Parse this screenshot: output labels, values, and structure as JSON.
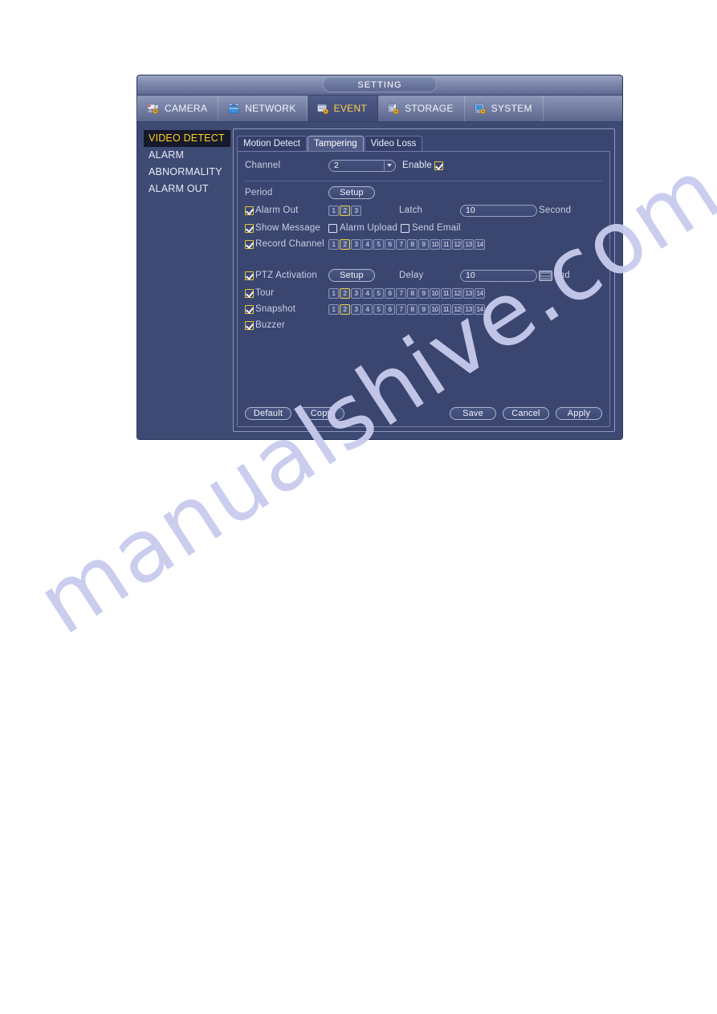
{
  "window": {
    "title": "SETTING"
  },
  "main_tabs": [
    {
      "label": "CAMERA",
      "icon": "camera-gear-icon",
      "active": false
    },
    {
      "label": "NETWORK",
      "icon": "network-icon",
      "active": false
    },
    {
      "label": "EVENT",
      "icon": "event-gear-icon",
      "active": true
    },
    {
      "label": "STORAGE",
      "icon": "storage-gear-icon",
      "active": false
    },
    {
      "label": "SYSTEM",
      "icon": "system-gear-icon",
      "active": false
    }
  ],
  "sidebar": {
    "items": [
      {
        "label": "VIDEO DETECT",
        "active": true
      },
      {
        "label": "ALARM",
        "active": false
      },
      {
        "label": "ABNORMALITY",
        "active": false
      },
      {
        "label": "ALARM OUT",
        "active": false
      }
    ]
  },
  "sub_tabs": [
    {
      "label": "Motion Detect",
      "active": false
    },
    {
      "label": "Tampering",
      "active": true
    },
    {
      "label": "Video Loss",
      "active": false
    }
  ],
  "form": {
    "channel_label": "Channel",
    "channel_value": "2",
    "enable_label": "Enable",
    "enable_checked": true,
    "period_label": "Period",
    "period_button": "Setup",
    "alarm_out_label": "Alarm Out",
    "alarm_out_checked": true,
    "alarm_out_chips": [
      "1",
      "2",
      "3"
    ],
    "alarm_out_selected": [
      "2"
    ],
    "latch_label": "Latch",
    "latch_value": "10",
    "latch_unit": "Second",
    "show_message_label": "Show Message",
    "show_message_checked": true,
    "alarm_upload_label": "Alarm Upload",
    "alarm_upload_checked": false,
    "send_email_label": "Send Email",
    "send_email_checked": false,
    "record_channel_label": "Record Channel",
    "record_channel_checked": true,
    "ptz_activation_label": "PTZ Activation",
    "ptz_activation_checked": true,
    "ptz_button": "Setup",
    "delay_label": "Delay",
    "delay_value": "10",
    "delay_unit": "ond",
    "delay_stepper": "spinner-icon",
    "tour_label": "Tour",
    "tour_checked": true,
    "snapshot_label": "Snapshot",
    "snapshot_checked": true,
    "buzzer_label": "Buzzer",
    "buzzer_checked": true,
    "channels": [
      "1",
      "2",
      "3",
      "4",
      "5",
      "6",
      "7",
      "8",
      "9",
      "10",
      "11",
      "12",
      "13",
      "14"
    ],
    "channels_selected": [
      "2"
    ]
  },
  "buttons": {
    "default": "Default",
    "copy": "Copy",
    "save": "Save",
    "cancel": "Cancel",
    "apply": "Apply"
  },
  "watermark": {
    "text": "manualshive.com"
  },
  "colors": {
    "accent_yellow": "#ffd21f",
    "panel_blue": "#3a4670",
    "window_blue": "#3d4a73",
    "chip_selected_border": "#f2cf3e"
  }
}
